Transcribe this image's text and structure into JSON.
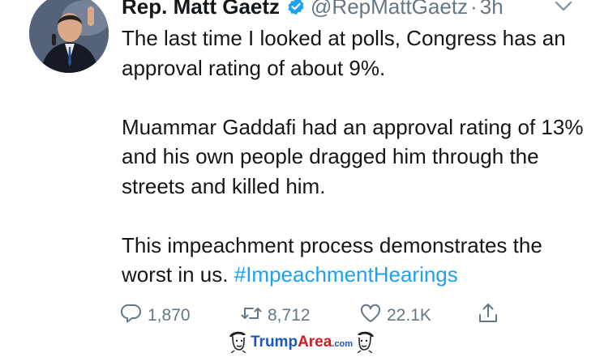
{
  "tweet": {
    "author_name": "Rep. Matt Gaetz",
    "handle": "@RepMattGaetz",
    "separator": "·",
    "time": "3h",
    "paragraphs": [
      "The last time I looked at polls, Congress has an approval rating of about 9%.",
      "Muammar Gaddafi had an approval rating of 13% and his own people dragged him through the streets and killed him.",
      "This impeachment process demonstrates the worst in us."
    ],
    "hashtag": "#ImpeachmentHearings",
    "actions": {
      "replies": "1,870",
      "retweets": "8,712",
      "likes": "22.1K"
    }
  },
  "icons": {
    "verified": "verified-badge-icon",
    "caret": "chevron-down-icon",
    "reply": "reply-icon",
    "retweet": "retweet-icon",
    "like": "heart-icon",
    "share": "share-icon"
  },
  "watermark": {
    "brand_primary": "Trump",
    "brand_secondary": "Area",
    "brand_suffix": ".com"
  },
  "colors": {
    "text": "#14171a",
    "secondary": "#657786",
    "link": "#1da1f2",
    "verified": "#1da1f2"
  }
}
